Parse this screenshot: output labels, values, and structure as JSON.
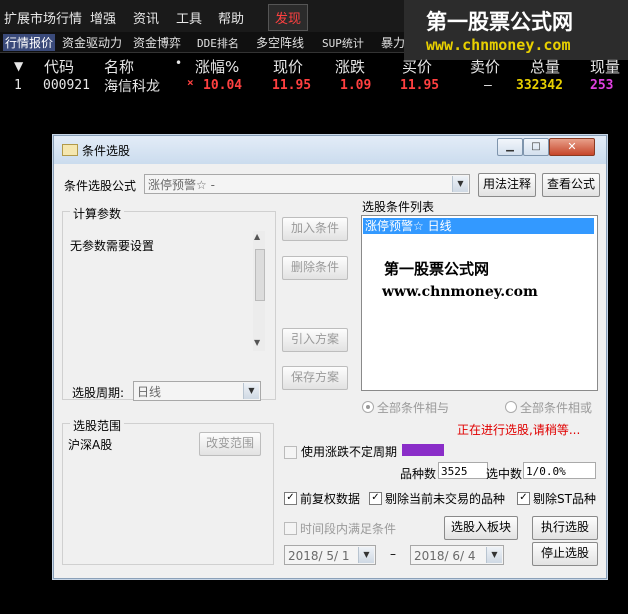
{
  "menubar": {
    "items": [
      "扩展市场行情",
      "增强",
      "资讯",
      "工具",
      "帮助"
    ],
    "discover": "发现"
  },
  "tabs": [
    "行情报价",
    "资金驱动力",
    "资金博弈",
    "DDE排名",
    "多空阵线",
    "SUP统计",
    "暴力"
  ],
  "watermark": {
    "title": "第一股票公式网",
    "url": "www.chnmoney.com"
  },
  "quote_table": {
    "headers": [
      "代码",
      "名称",
      "•",
      "涨幅%",
      "现价",
      "涨跌",
      "买价",
      "卖价",
      "总量",
      "现量"
    ],
    "row": {
      "index": "1",
      "code": "000921",
      "name": "海信科龙",
      "mark": "×",
      "change_pct": "10.04",
      "price": "11.95",
      "change": "1.09",
      "bid": "11.95",
      "ask": "—",
      "volume": "332342",
      "cur_volume": "253"
    }
  },
  "dialog": {
    "title": "条件选股",
    "formula_label": "条件选股公式",
    "formula_value": "涨停预警☆  -",
    "usage_button": "用法注释",
    "view_formula_button": "查看公式",
    "params_group": "计算参数",
    "params_text": "无参数需要设置",
    "list_group": "选股条件列表",
    "list_item": "涨停预警☆  日线",
    "add_condition": "加入条件",
    "delete_condition": "删除条件",
    "import_plan": "引入方案",
    "save_plan": "保存方案",
    "period_label": "选股周期:",
    "period_value": "日线",
    "radio_and": "全部条件相与",
    "radio_or": "全部条件相或",
    "range_group": "选股范围",
    "range_value": "沪深A股",
    "change_range": "改变范围",
    "status": "正在进行选股,请稍等...",
    "progress": 0.22,
    "variable_period": "使用涨跌不定周期",
    "count_label": "品种数",
    "count_value": "3525",
    "selected_label": "选中数",
    "selected_value": "1/0.0%",
    "chk_adjust": "前复权数据",
    "chk_skip_untraded": "剔除当前未交易的品种",
    "chk_skip_st": "剔除ST品种",
    "chk_time_range": "时间段内满足条件",
    "to_block": "选股入板块",
    "run": "执行选股",
    "stop": "停止选股",
    "date_from": "2018/ 5/ 1",
    "date_sep": "–",
    "date_to": "2018/ 6/ 4",
    "overlay_title": "第一股票公式网",
    "overlay_url": "www.chnmoney.com"
  }
}
